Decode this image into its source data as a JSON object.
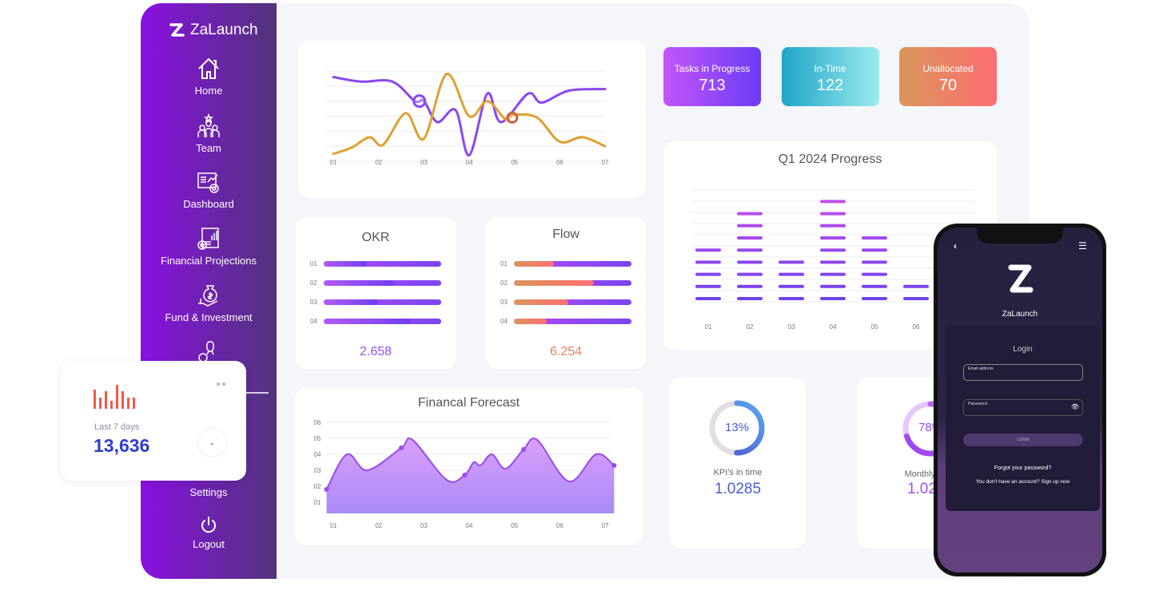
{
  "app": {
    "name": "ZaLaunch"
  },
  "sidebar": {
    "items": [
      {
        "label": "Home",
        "icon": "home-icon"
      },
      {
        "label": "Team",
        "icon": "team-icon"
      },
      {
        "label": "Dashboard",
        "icon": "dashboard-icon"
      },
      {
        "label": "Financial Projections",
        "icon": "financial-projections-icon"
      },
      {
        "label": "Fund & Investment",
        "icon": "fund-investment-icon"
      },
      {
        "label": "",
        "icon": "startup-rocket-icon"
      },
      {
        "label": "Settings",
        "icon": "settings-icon"
      },
      {
        "label": "Logout",
        "icon": "power-icon"
      }
    ]
  },
  "stats": [
    {
      "label": "Tasks in Progress",
      "value": "713",
      "colors": [
        "#c455fb",
        "#6a3cf6"
      ]
    },
    {
      "label": "In-Time",
      "value": "122",
      "colors": [
        "#1fa5c9",
        "#9bebee"
      ]
    },
    {
      "label": "Unallocated",
      "value": "70",
      "colors": [
        "#d9955a",
        "#ff6f72"
      ]
    }
  ],
  "okr": {
    "title": "OKR",
    "rows": [
      "01",
      "02",
      "03",
      "04"
    ],
    "fractions": [
      0.37,
      0.6,
      0.46,
      0.74
    ],
    "value": "2.658"
  },
  "flow": {
    "title": "Flow",
    "rows": [
      "01",
      "02",
      "03",
      "04"
    ],
    "fractions": [
      0.34,
      0.68,
      0.46,
      0.28
    ],
    "value": "6.254"
  },
  "kpi": {
    "percent_label": "13%",
    "arc_fraction": 0.5,
    "label": "KPI's in time",
    "value": "1.0285"
  },
  "burn": {
    "percent_label": "78%",
    "arc_fraction": 0.7,
    "label": "Monthly Burn",
    "value": "1.0285"
  },
  "floating_card": {
    "label": "Last 7 days",
    "value": "13,636",
    "bars": [
      24,
      14,
      22,
      10,
      30,
      22,
      14,
      14
    ],
    "bar_color": "#f4574a"
  },
  "phone": {
    "app_name": "ZaLaunch",
    "login_title": "Login",
    "email_placeholder": "Email address",
    "password_placeholder": "Password",
    "login_button": "LOGIN",
    "forgot": "Forgot your password?",
    "signup": "You don't have an account? Sign up now"
  },
  "chart_data": [
    {
      "type": "line",
      "title": "",
      "categories": [
        "01",
        "02",
        "03",
        "04",
        "05",
        "06",
        "07"
      ],
      "ylim": [
        0,
        6
      ],
      "grid": true,
      "series": [
        {
          "color": "#8a46f5",
          "points": [
            [
              1,
              5.6
            ],
            [
              1.6,
              5.3
            ],
            [
              2.3,
              5.3
            ],
            [
              2.8,
              4
            ],
            [
              3,
              4
            ],
            [
              3.3,
              2.6
            ],
            [
              3.7,
              3.4
            ],
            [
              4,
              0.4
            ],
            [
              4.4,
              4.5
            ],
            [
              4.7,
              2.6
            ],
            [
              5.3,
              4.5
            ],
            [
              5.6,
              3.9
            ],
            [
              6.2,
              4.7
            ],
            [
              7,
              4.8
            ]
          ]
        },
        {
          "color": "#e0a030",
          "points": [
            [
              1,
              0.5
            ],
            [
              1.4,
              0.9
            ],
            [
              1.8,
              1.6
            ],
            [
              2.1,
              1.1
            ],
            [
              2.6,
              3.2
            ],
            [
              3,
              1.5
            ],
            [
              3.5,
              5.8
            ],
            [
              4,
              3
            ],
            [
              4.4,
              4
            ],
            [
              4.8,
              2.8
            ],
            [
              5,
              3.1
            ],
            [
              5.5,
              2.9
            ],
            [
              6,
              1.3
            ],
            [
              6.5,
              1.6
            ],
            [
              7,
              1
            ]
          ]
        }
      ],
      "markers": [
        {
          "x": 2.9,
          "y": 4
        },
        {
          "x": 4.95,
          "y": 2.9
        }
      ]
    },
    {
      "type": "bar",
      "title": "Q1 2024 Progress",
      "categories": [
        "01",
        "02",
        "03",
        "04",
        "05",
        "06"
      ],
      "values": [
        5,
        8,
        4,
        9,
        6,
        2
      ],
      "ylim": [
        0,
        10
      ],
      "grid": true
    },
    {
      "type": "area",
      "title": "Financal Forecast",
      "categories": [
        "01",
        "02",
        "03",
        "04",
        "05",
        "06",
        "07"
      ],
      "yticks": [
        "01",
        "02",
        "03",
        "04",
        "05",
        "06"
      ],
      "ylim": [
        0.3,
        6
      ],
      "grid": true,
      "points": [
        [
          0.85,
          1.8
        ],
        [
          1.3,
          4
        ],
        [
          1.75,
          3
        ],
        [
          2.5,
          4.4
        ],
        [
          2.75,
          4.9
        ],
        [
          3.5,
          2.4
        ],
        [
          3.9,
          2.7
        ],
        [
          4.1,
          3.5
        ],
        [
          4.25,
          3.3
        ],
        [
          4.5,
          4
        ],
        [
          4.8,
          3.1
        ],
        [
          5.2,
          4.3
        ],
        [
          5.5,
          4.9
        ],
        [
          6.2,
          2.3
        ],
        [
          6.8,
          4
        ],
        [
          7.2,
          3.3
        ]
      ],
      "markers": [
        [
          0.85,
          1.8
        ],
        [
          2.5,
          4.4
        ],
        [
          3.9,
          2.7
        ],
        [
          5.2,
          4.3
        ],
        [
          7.2,
          3.3
        ]
      ]
    }
  ]
}
